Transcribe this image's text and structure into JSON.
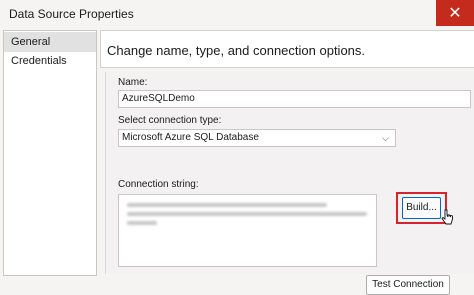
{
  "window": {
    "title": "Data Source Properties",
    "close_glyph": "✕"
  },
  "nav": {
    "items": [
      {
        "label": "General"
      },
      {
        "label": "Credentials"
      }
    ]
  },
  "main": {
    "header": "Change name, type, and connection options.",
    "name_label": "Name:",
    "name_value": "AzureSQLDemo",
    "type_label": "Select connection type:",
    "type_value": "Microsoft Azure SQL Database",
    "connstr_label": "Connection string:",
    "build_label": "Build...",
    "test_label": "Test Connection"
  },
  "colors": {
    "highlight": "#d9232a",
    "close_button": "#c42b1c"
  }
}
